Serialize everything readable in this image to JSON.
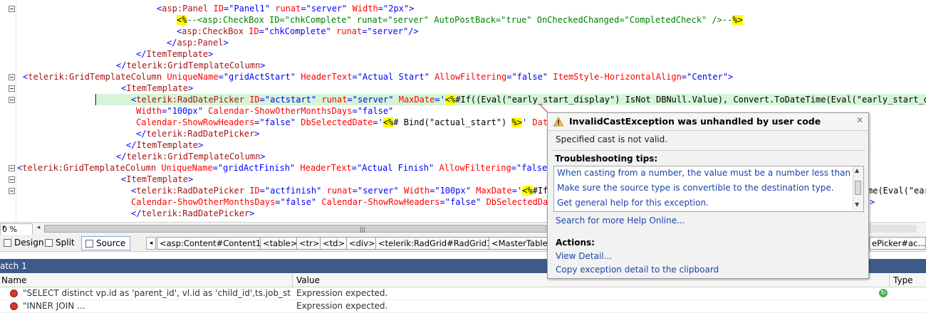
{
  "code_lines": [
    {
      "tokens": [
        [
          "br",
          "<"
        ],
        [
          "tag",
          "asp:Panel"
        ],
        [
          "txt",
          " "
        ],
        [
          "attr",
          "ID"
        ],
        [
          "br",
          "=\""
        ],
        [
          "val",
          "Panel1"
        ],
        [
          "br",
          "\""
        ],
        [
          "txt",
          " "
        ],
        [
          "attr",
          "runat"
        ],
        [
          "br",
          "=\""
        ],
        [
          "val",
          "server"
        ],
        [
          "br",
          "\""
        ],
        [
          "txt",
          " "
        ],
        [
          "attr",
          "Width"
        ],
        [
          "br",
          "=\""
        ],
        [
          "val",
          "2px"
        ],
        [
          "br",
          "\">"
        ]
      ]
    },
    {
      "tokens": [
        [
          "asp",
          "<%"
        ],
        [
          "cm",
          "--<asp:CheckBox ID=\"chkComplete\" runat=\"server\" AutoPostBack=\"true\" OnCheckedChanged=\"CompletedCheck\" />--"
        ],
        [
          "asp",
          "%>"
        ]
      ]
    },
    {
      "tokens": [
        [
          "br",
          "<"
        ],
        [
          "tag",
          "asp:CheckBox"
        ],
        [
          "txt",
          " "
        ],
        [
          "attr",
          "ID"
        ],
        [
          "br",
          "=\""
        ],
        [
          "val",
          "chkComplete"
        ],
        [
          "br",
          "\""
        ],
        [
          "txt",
          " "
        ],
        [
          "attr",
          "runat"
        ],
        [
          "br",
          "=\""
        ],
        [
          "val",
          "server"
        ],
        [
          "br",
          "\"/>"
        ]
      ]
    },
    {
      "tokens": [
        [
          "br",
          "</"
        ],
        [
          "tag",
          "asp:Panel"
        ],
        [
          "br",
          ">"
        ]
      ]
    },
    {
      "tokens": [
        [
          "br",
          "</"
        ],
        [
          "tag",
          "ItemTemplate"
        ],
        [
          "br",
          ">"
        ]
      ]
    },
    {
      "tokens": [
        [
          "br",
          "</"
        ],
        [
          "tag",
          "telerik:GridTemplateColumn"
        ],
        [
          "br",
          ">"
        ]
      ]
    },
    {
      "tokens": [
        [
          "br",
          "<"
        ],
        [
          "tag",
          "telerik:GridTemplateColumn"
        ],
        [
          "txt",
          " "
        ],
        [
          "attr",
          "UniqueName"
        ],
        [
          "br",
          "=\""
        ],
        [
          "val",
          "gridActStart"
        ],
        [
          "br",
          "\""
        ],
        [
          "txt",
          " "
        ],
        [
          "attr",
          "HeaderText"
        ],
        [
          "br",
          "=\""
        ],
        [
          "val",
          "Actual Start"
        ],
        [
          "br",
          "\""
        ],
        [
          "txt",
          " "
        ],
        [
          "attr",
          "AllowFiltering"
        ],
        [
          "br",
          "=\""
        ],
        [
          "val",
          "false"
        ],
        [
          "br",
          "\""
        ],
        [
          "txt",
          " "
        ],
        [
          "attr",
          "ItemStyle-HorizontalAlign"
        ],
        [
          "br",
          "=\""
        ],
        [
          "val",
          "Center"
        ],
        [
          "br",
          "\">"
        ]
      ]
    },
    {
      "tokens": [
        [
          "br",
          "<"
        ],
        [
          "tag",
          "ItemTemplate"
        ],
        [
          "br",
          ">"
        ]
      ]
    },
    {
      "tokens": [
        [
          "br",
          "<"
        ],
        [
          "tag",
          "telerik:RadDatePicker"
        ],
        [
          "txt",
          " "
        ],
        [
          "attr",
          "ID"
        ],
        [
          "br",
          "=\""
        ],
        [
          "val",
          "actstart"
        ],
        [
          "br",
          "\""
        ],
        [
          "txt",
          " "
        ],
        [
          "attr",
          "runat"
        ],
        [
          "br",
          "=\""
        ],
        [
          "val",
          "server"
        ],
        [
          "br",
          "\""
        ],
        [
          "txt",
          " "
        ],
        [
          "attr",
          "MaxDate"
        ],
        [
          "br",
          "='"
        ],
        [
          "asp",
          "<%"
        ],
        [
          "txt",
          "#If((Eval(\"early_start_display\") IsNot DBNull.Value), Convert.ToDateTime(Eval(\"early_start_displa"
        ]
      ]
    },
    {
      "tokens": [
        [
          "attr",
          "Width"
        ],
        [
          "br",
          "=\""
        ],
        [
          "val",
          "100px"
        ],
        [
          "br",
          "\""
        ],
        [
          "txt",
          " "
        ],
        [
          "attr",
          "Calendar-ShowOtherMonthsDays"
        ],
        [
          "br",
          "=\""
        ],
        [
          "val",
          "false"
        ],
        [
          "br",
          "\""
        ]
      ]
    },
    {
      "tokens": [
        [
          "attr",
          "Calendar-ShowRowHeaders"
        ],
        [
          "br",
          "=\""
        ],
        [
          "val",
          "false"
        ],
        [
          "br",
          "\""
        ],
        [
          "txt",
          " "
        ],
        [
          "attr",
          "DbSelectedDate"
        ],
        [
          "br",
          "='"
        ],
        [
          "asp",
          "<%"
        ],
        [
          "txt",
          "# Bind(\"actual_start\") "
        ],
        [
          "asp",
          "%>"
        ],
        [
          "br",
          "'"
        ],
        [
          "txt",
          " "
        ],
        [
          "attr",
          "DateIn"
        ]
      ]
    },
    {
      "tokens": [
        [
          "br",
          "</"
        ],
        [
          "tag",
          "telerik:RadDatePicker"
        ],
        [
          "br",
          ">"
        ]
      ]
    },
    {
      "tokens": [
        [
          "br",
          "</"
        ],
        [
          "tag",
          "ItemTemplate"
        ],
        [
          "br",
          ">"
        ]
      ]
    },
    {
      "tokens": [
        [
          "br",
          "</"
        ],
        [
          "tag",
          "telerik:GridTemplateColumn"
        ],
        [
          "br",
          ">"
        ]
      ]
    },
    {
      "tokens": [
        [
          "br",
          "<"
        ],
        [
          "tag",
          "telerik:GridTemplateColumn"
        ],
        [
          "txt",
          " "
        ],
        [
          "attr",
          "UniqueName"
        ],
        [
          "br",
          "=\""
        ],
        [
          "val",
          "gridActFinish"
        ],
        [
          "br",
          "\""
        ],
        [
          "txt",
          " "
        ],
        [
          "attr",
          "HeaderText"
        ],
        [
          "br",
          "=\""
        ],
        [
          "val",
          "Actual Finish"
        ],
        [
          "br",
          "\""
        ],
        [
          "txt",
          " "
        ],
        [
          "attr",
          "AllowFiltering"
        ],
        [
          "br",
          "=\""
        ],
        [
          "val",
          "false"
        ],
        [
          "br",
          "\""
        ],
        [
          "txt",
          " "
        ],
        [
          "attr",
          "It"
        ]
      ]
    },
    {
      "tokens": [
        [
          "br",
          "<"
        ],
        [
          "tag",
          "ItemTemplate"
        ],
        [
          "br",
          ">"
        ]
      ]
    },
    {
      "tokens": [
        [
          "br",
          "<"
        ],
        [
          "tag",
          "telerik:RadDatePicker"
        ],
        [
          "txt",
          " "
        ],
        [
          "attr",
          "ID"
        ],
        [
          "br",
          "=\""
        ],
        [
          "val",
          "actfinish"
        ],
        [
          "br",
          "\""
        ],
        [
          "txt",
          " "
        ],
        [
          "attr",
          "runat"
        ],
        [
          "br",
          "=\""
        ],
        [
          "val",
          "server"
        ],
        [
          "br",
          "\""
        ],
        [
          "txt",
          " "
        ],
        [
          "attr",
          "Width"
        ],
        [
          "br",
          "=\""
        ],
        [
          "val",
          "100px"
        ],
        [
          "br",
          "\""
        ],
        [
          "txt",
          " "
        ],
        [
          "attr",
          "MaxDate"
        ],
        [
          "br",
          "='"
        ],
        [
          "asp",
          "<%"
        ],
        [
          "txt",
          "#If((E"
        ]
      ]
    },
    {
      "tokens": [
        [
          "attr",
          "Calendar-ShowOtherMonthsDays"
        ],
        [
          "br",
          "=\""
        ],
        [
          "val",
          "false"
        ],
        [
          "br",
          "\""
        ],
        [
          "txt",
          " "
        ],
        [
          "attr",
          "Calendar-ShowRowHeaders"
        ],
        [
          "br",
          "=\""
        ],
        [
          "val",
          "false"
        ],
        [
          "br",
          "\""
        ],
        [
          "txt",
          " "
        ],
        [
          "attr",
          "DbSelectedDate"
        ],
        [
          "br",
          "="
        ]
      ]
    },
    {
      "tokens": [
        [
          "br",
          "</"
        ],
        [
          "tag",
          "telerik:RadDatePicker"
        ],
        [
          "br",
          ">"
        ]
      ]
    }
  ],
  "right_fragments": {
    "line16": "me(Eval(\"ear",
    "line17": ">"
  },
  "zoom": {
    "value": "0 %"
  },
  "view_buttons": [
    {
      "label": "Design",
      "icon": "design-view-icon"
    },
    {
      "label": "Split",
      "icon": "split-view-icon"
    },
    {
      "label": "Source",
      "icon": "source-view-icon"
    }
  ],
  "breadcrumbs": [
    "<asp:Content#Content1>",
    "<table>",
    "<tr>",
    "<td>",
    "<div>",
    "<telerik:RadGrid#RadGrid1>",
    "<MasterTableV",
    "ePicker#ac..."
  ],
  "watch": {
    "title": "atch 1",
    "columns": [
      "Name",
      "Value",
      "Type"
    ],
    "rows": [
      {
        "name": "\"SELECT distinct vp.id as 'parent_id', vl.id as 'child_id',ts.job_status, vl.co",
        "value": "Expression expected."
      },
      {
        "name": "\"INNER JOIN ...",
        "value": "Expression expected."
      }
    ]
  },
  "exception": {
    "title": "InvalidCastException was unhandled by user code",
    "message": "Specified cast is not valid.",
    "tips_heading": "Troubleshooting tips:",
    "tips": [
      "When casting from a number, the value must be a number less than infinity.",
      "Make sure the source type is convertible to the destination type.",
      "Get general help for this exception."
    ],
    "search_link": "Search for more Help Online...",
    "actions_heading": "Actions:",
    "actions": [
      "View Detail...",
      "Copy exception detail to the clipboard"
    ]
  }
}
